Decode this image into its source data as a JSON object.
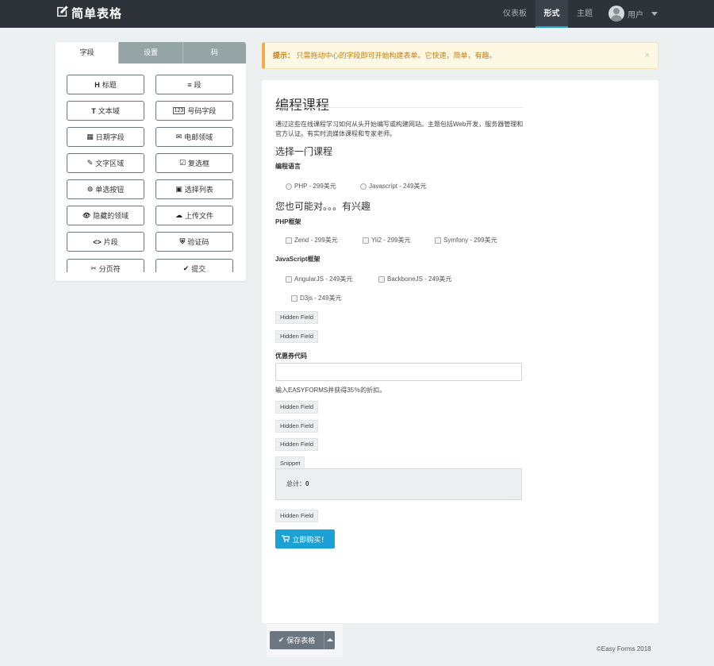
{
  "navbar": {
    "brand": "简单表格",
    "items": [
      "仪表板",
      "形式",
      "主题"
    ],
    "active_index": 1,
    "user_label": "用户"
  },
  "sidebar": {
    "tabs": [
      "字段",
      "设置",
      "码"
    ],
    "active_tab": 0,
    "fields": [
      {
        "icon": "H",
        "label": "标题"
      },
      {
        "icon": "≡",
        "label": "段"
      },
      {
        "icon": "T",
        "label": "文本域"
      },
      {
        "icon": "123",
        "label": "号码字段"
      },
      {
        "icon": "▦",
        "label": "日期字段"
      },
      {
        "icon": "✉",
        "label": "电邮领域"
      },
      {
        "icon": "✎",
        "label": "文字区域"
      },
      {
        "icon": "☑",
        "label": "复选框"
      },
      {
        "icon": "⊙",
        "label": "单选按钮"
      },
      {
        "icon": "▣",
        "label": "选择列表"
      },
      {
        "icon": "👁",
        "label": "隐藏的领域"
      },
      {
        "icon": "☁",
        "label": "上传文件"
      },
      {
        "icon": "<>",
        "label": "片段"
      },
      {
        "icon": "⛨",
        "label": "验证码"
      },
      {
        "icon": "✂",
        "label": "分页符"
      },
      {
        "icon": "✔",
        "label": "提交"
      }
    ]
  },
  "alert": {
    "prefix": "提示：",
    "text": "只需拖动中心的字段即可开始构建表单。它快速，简单，有趣。",
    "close": "×"
  },
  "form": {
    "title": "编程课程",
    "description": "通过这些在线课程学习如何从头开始编写或构建网站。主题包括Web开发，服务器管理和官方认证。有实时流媒体课程和专家老师。",
    "choose_heading": "选择一门课程",
    "language_label": "编程语言",
    "language_options": [
      "PHP - 299美元",
      "Javascript - 249美元"
    ],
    "interest_heading": "您也可能对。。。有兴趣",
    "php_label": "PHP框架",
    "php_options": [
      "Zend - 299美元",
      "Yii2 - 299美元",
      "Symfony - 299美元"
    ],
    "js_label": "JavaScript框架",
    "js_options": [
      "AngularJS - 249美元",
      "BackboneJS - 249美元",
      "D3js - 249美元"
    ],
    "hidden_field_label": "Hidden Field",
    "coupon_label": "优惠券代码",
    "coupon_value": "",
    "coupon_help": "输入EASYFORMS并获得35％的折扣。",
    "snippet_label": "Snippet",
    "total_label": "总计：",
    "total_value": "0",
    "buy_button": "立即购买！"
  },
  "bottom": {
    "save_button": "保存表格",
    "footer": "©Easy Forms 2018"
  },
  "colors": {
    "navbar": "#2d3339",
    "accent": "#1ba1d5",
    "alert_text": "#c77c0e",
    "save_button": "#6b7680"
  }
}
